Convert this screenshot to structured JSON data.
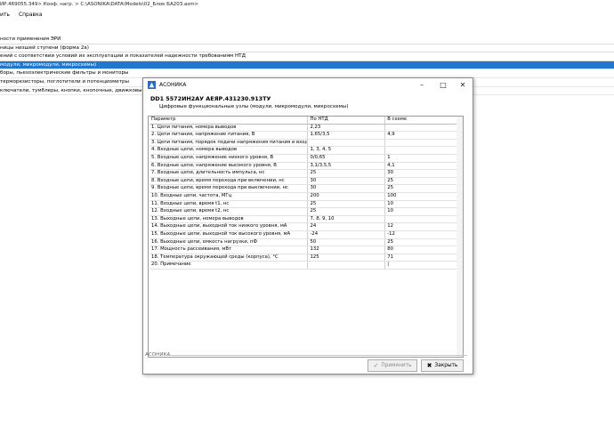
{
  "window": {
    "title": "ИР.469055.349> Коэф. нагр. > C:\\ASONIKA\\DATA\\Models\\02_Блок БА203.asm>"
  },
  "menu": {
    "item1": "ить",
    "item2": "Справка"
  },
  "bg_list": [
    "ности применения ЭРИ",
    "ницы низшей ступени (форма 2а)",
    "ений с соответствии условий их эксплуатации и показателей надежности требованиям НТД",
    "модули, микромодули, микросхемы)",
    "боры, пьезоэлектрические фильтры и мониторы",
    "терморезисторы, поглотители и потенциометры",
    "ключатели, тумблеры, кнопки, кнопочные, движковые, поворотные"
  ],
  "dialog": {
    "title": "АСОНИКА",
    "device": "DD1 5572ИН2АУ АЕЯР.431230.913ТУ",
    "subtitle": "Цифровые функциональные узлы (модули, микромодули, микросхемы)",
    "columns": [
      "Параметр",
      "По НТД",
      "В схеме"
    ],
    "rows": [
      [
        "1. Цепи питания, номера выводов",
        "2,23",
        ""
      ],
      [
        "2. Цепи питания, напряжение питания, В",
        "1,65/3,5",
        "4,9"
      ],
      [
        "3. Цепи питания, порядок подачи напряжения питания и входных сигналов",
        "",
        ""
      ],
      [
        "4. Входные цепи, номера выводов",
        "1, 3, 4, 5",
        ""
      ],
      [
        "5. Входные цепи, напряжение низкого уровня, В",
        "0/0,65",
        "1"
      ],
      [
        "6. Входные цепи, напряжение высокого уровня, В",
        "3,1/3,5,5",
        "4,1"
      ],
      [
        "7. Входные цепи, длительность импульса, нс",
        "25",
        "30"
      ],
      [
        "8. Входные цепи, время перехода при включении, нс",
        "30",
        "25"
      ],
      [
        "9. Входные цепи, время перехода при выключении, нс",
        "30",
        "25"
      ],
      [
        "10. Входные цепи, частота, МГц",
        "200",
        "100"
      ],
      [
        "11. Входные цепи, время t1, нс",
        "25",
        "10"
      ],
      [
        "12. Входные цепи, время t2, нс",
        "25",
        "10"
      ],
      [
        "13. Выходные цепи, номера выводов",
        "7, 8, 9, 10",
        ""
      ],
      [
        "14. Выходные цепи, выходной ток низкого уровня, мА",
        "24",
        "12"
      ],
      [
        "15. Выходные цепи, выходной ток высокого уровня, мА",
        "-24",
        "-12"
      ],
      [
        "16. Выходные цепи, емкость нагрузки, пФ",
        "50",
        "25"
      ],
      [
        "17. Мощность рассеивания, мВт",
        "132",
        "80"
      ],
      [
        "18. Температура окружающей среды (корпуса), °С",
        "125",
        "71"
      ],
      [
        "20. Примечание",
        "",
        "|"
      ]
    ],
    "footer_label": "АСОНИКА",
    "apply_label": "Применить",
    "close_label": "Закрыть"
  }
}
